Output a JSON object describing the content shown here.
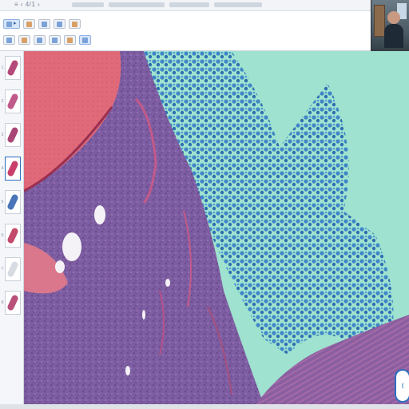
{
  "window": {
    "title": "≡ ‹ 4/1 ›"
  },
  "toolbar": {
    "row1": [
      {
        "label": "▸",
        "icon": "play-icon"
      },
      {
        "label": "",
        "icon": "grid-icon"
      },
      {
        "label": "",
        "icon": "pen-icon"
      },
      {
        "label": "",
        "icon": "ruler-icon"
      },
      {
        "label": "",
        "icon": "layers-icon"
      }
    ],
    "row2": [
      {
        "label": "",
        "icon": "zoom-in-icon"
      },
      {
        "label": "",
        "icon": "zoom-out-icon"
      },
      {
        "label": "",
        "icon": "pan-icon"
      },
      {
        "label": "",
        "icon": "annotate-icon"
      },
      {
        "label": "",
        "icon": "rotate-icon"
      },
      {
        "label": "",
        "icon": "fullscreen-icon"
      }
    ]
  },
  "thumbnails": [
    {
      "index": "1",
      "color": "#b44a7a",
      "selected": false
    },
    {
      "index": "2",
      "color": "#c05a8a",
      "selected": false
    },
    {
      "index": "3",
      "color": "#a84676",
      "selected": false
    },
    {
      "index": "4",
      "color": "#c8406a",
      "selected": true
    },
    {
      "index": "5",
      "color": "#4a74b8",
      "selected": false
    },
    {
      "index": "6",
      "color": "#c24a6a",
      "selected": false
    },
    {
      "index": "7",
      "color": "#d7dce3",
      "selected": false
    },
    {
      "index": "8",
      "color": "#b8507a",
      "selected": false
    }
  ],
  "viewer": {
    "stain_colors": {
      "background": "#9ee2cf",
      "pink": "#e06a7a",
      "purple": "#7e5ea2",
      "blue": "#3f86c8"
    }
  },
  "fab": {
    "icon": "chevron-icon"
  }
}
